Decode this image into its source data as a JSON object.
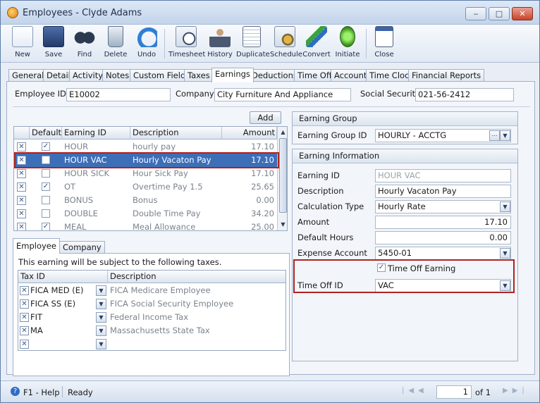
{
  "window": {
    "title": "Employees - Clyde Adams",
    "min": "‒",
    "max": "□",
    "close": "✕"
  },
  "toolbar": [
    {
      "label": "New",
      "icon": "new-document-icon"
    },
    {
      "label": "Save",
      "icon": "save-disk-icon"
    },
    {
      "label": "Find",
      "icon": "binoculars-icon"
    },
    {
      "label": "Delete",
      "icon": "trash-bin-icon"
    },
    {
      "label": "Undo",
      "icon": "undo-arrow-icon"
    },
    {
      "label": "Timesheet",
      "icon": "timesheet-clock-icon"
    },
    {
      "label": "History",
      "icon": "history-user-icon"
    },
    {
      "label": "Duplicate",
      "icon": "duplicate-pages-icon"
    },
    {
      "label": "Schedule",
      "icon": "schedule-gear-icon"
    },
    {
      "label": "Convert",
      "icon": "convert-arrows-icon"
    },
    {
      "label": "Initiate",
      "icon": "initiate-traffic-light-icon"
    },
    {
      "label": "Close",
      "icon": "close-window-icon"
    }
  ],
  "tabs": [
    "General",
    "Detail",
    "Activity",
    "Notes",
    "Custom Fields",
    "Taxes",
    "Earnings",
    "Deductions",
    "Time Off",
    "Account",
    "Time Clock",
    "Financial Reports"
  ],
  "active_tab": "Earnings",
  "header": {
    "emp_id_label": "Employee ID",
    "emp_id": "E10002",
    "company_label": "Company",
    "company": "City Furniture And Appliance",
    "ssn_label": "Social Security",
    "ssn": "021-56-2412"
  },
  "earnings": {
    "add_label": "Add",
    "columns": [
      "Default",
      "Earning ID",
      "Description",
      "Amount"
    ],
    "rows": [
      {
        "default": true,
        "id": "HOUR",
        "desc": "hourly pay",
        "amount": "17.10"
      },
      {
        "default": false,
        "id": "HOUR VAC",
        "desc": "Hourly Vacaton Pay",
        "amount": "17.10",
        "selected": true
      },
      {
        "default": false,
        "id": "HOUR SICK",
        "desc": "Hour Sick Pay",
        "amount": "17.10"
      },
      {
        "default": true,
        "id": "OT",
        "desc": "Overtime Pay 1.5",
        "amount": "25.65"
      },
      {
        "default": false,
        "id": "BONUS",
        "desc": "Bonus",
        "amount": "0.00"
      },
      {
        "default": false,
        "id": "DOUBLE",
        "desc": "Double Time Pay",
        "amount": "34.20"
      },
      {
        "default": true,
        "id": "MEAL",
        "desc": "Meal Allowance",
        "amount": "25.00"
      }
    ]
  },
  "subtabs": [
    "Employee",
    "Company"
  ],
  "taxes": {
    "note": "This earning will be subject to the following taxes.",
    "columns": [
      "Tax ID",
      "Description"
    ],
    "rows": [
      {
        "id": "FICA MED (E)",
        "desc": "FICA Medicare Employee"
      },
      {
        "id": "FICA SS (E)",
        "desc": "FICA Social Security Employee"
      },
      {
        "id": "FIT",
        "desc": "Federal Income Tax"
      },
      {
        "id": "MA",
        "desc": "Massachusetts State Tax"
      },
      {
        "id": "",
        "desc": ""
      }
    ]
  },
  "earning_group": {
    "header": "Earning Group",
    "label": "Earning Group ID",
    "value": "HOURLY - ACCTG"
  },
  "earning_info": {
    "header": "Earning Information",
    "earning_id_label": "Earning ID",
    "earning_id": "HOUR VAC",
    "description_label": "Description",
    "description": "Hourly Vacaton Pay",
    "calc_type_label": "Calculation Type",
    "calc_type": "Hourly Rate",
    "amount_label": "Amount",
    "amount": "17.10",
    "default_hours_label": "Default Hours",
    "default_hours": "0.00",
    "expense_account_label": "Expense Account",
    "expense_account": "5450-01",
    "time_off_earning_label": "Time Off Earning",
    "time_off_earning": true,
    "time_off_id_label": "Time Off ID",
    "time_off_id": "VAC"
  },
  "status": {
    "help": "F1 - Help",
    "state": "Ready",
    "page": "1",
    "of": "of 1"
  }
}
